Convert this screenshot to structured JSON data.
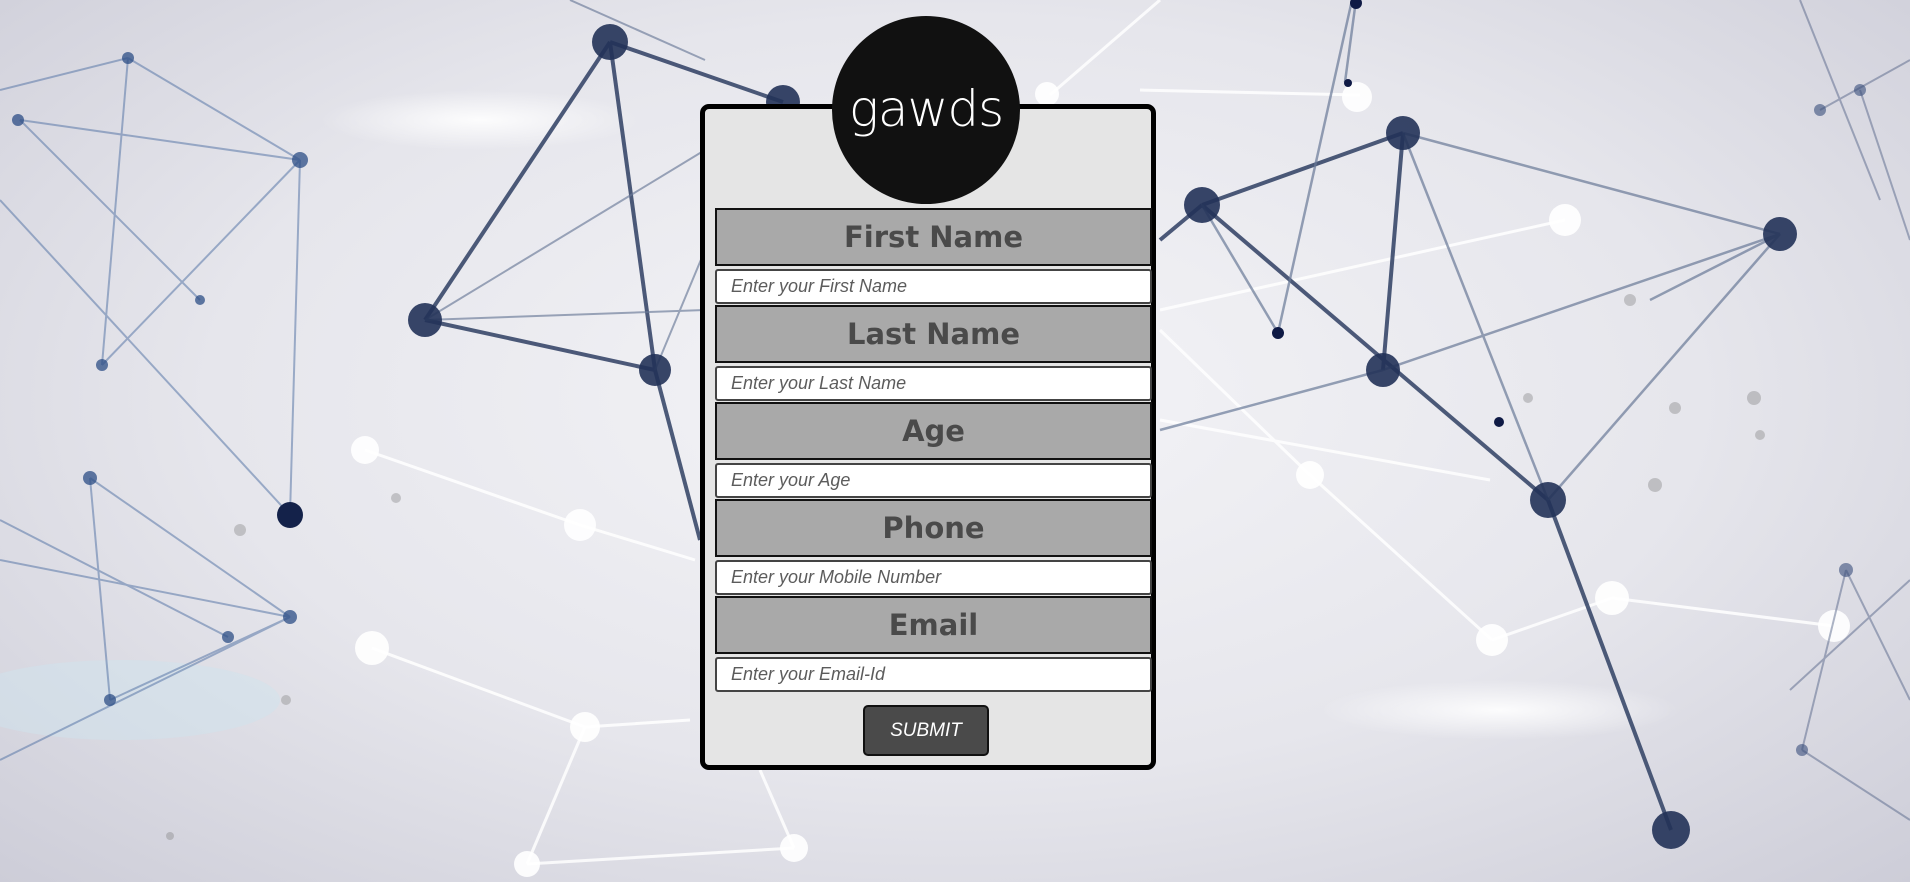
{
  "logo": {
    "text": "gawds"
  },
  "form": {
    "fields": [
      {
        "label": "First Name",
        "placeholder": "Enter your First Name"
      },
      {
        "label": "Last Name",
        "placeholder": "Enter your Last Name"
      },
      {
        "label": "Age",
        "placeholder": "Enter your Age"
      },
      {
        "label": "Phone",
        "placeholder": "Enter your Mobile Number"
      },
      {
        "label": "Email",
        "placeholder": "Enter your Email-Id"
      }
    ],
    "submit_label": "SUBMIT"
  },
  "colors": {
    "card_background": "#e5e5e5",
    "label_background": "#a9a9a9",
    "label_text": "#4a4a4a",
    "logo_background": "#111111",
    "submit_background": "#4a4a4a",
    "network_node": "#1f2f4d"
  }
}
